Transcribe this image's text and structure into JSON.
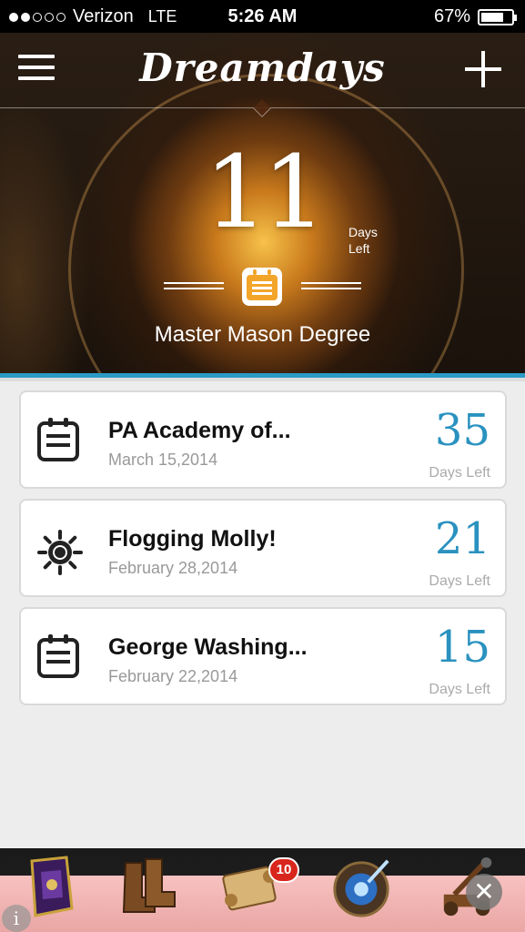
{
  "status_bar": {
    "carrier": "Verizon",
    "network": "LTE",
    "time": "5:26 AM",
    "battery": "67%",
    "signal_bars_filled": 2,
    "signal_bars_total": 5
  },
  "header": {
    "title": "Dreamdays"
  },
  "hero": {
    "count": "11",
    "days_label_1": "Days",
    "days_label_2": "Left",
    "event_title": "Master Mason Degree",
    "icon": "calendar-icon"
  },
  "events": [
    {
      "title": "PA Academy of...",
      "date": "March 15,2014",
      "count": "35",
      "days_left": "Days Left",
      "icon": "calendar-icon"
    },
    {
      "title": "Flogging Molly!",
      "date": "February 28,2014",
      "count": "21",
      "days_left": "Days Left",
      "icon": "sun-icon"
    },
    {
      "title": "George Washing...",
      "date": "February 22,2014",
      "count": "15",
      "days_left": "Days Left",
      "icon": "calendar-icon"
    }
  ],
  "ad_banner": {
    "badge_count": "10",
    "items": [
      "spellbook-icon",
      "boots-icon",
      "scroll-icon",
      "magic-orb-icon",
      "catapult-icon"
    ],
    "close_symbol": "✕",
    "info_symbol": "i"
  },
  "colors": {
    "accent": "#2a92bf",
    "hero_icon": "#f3a52a"
  }
}
